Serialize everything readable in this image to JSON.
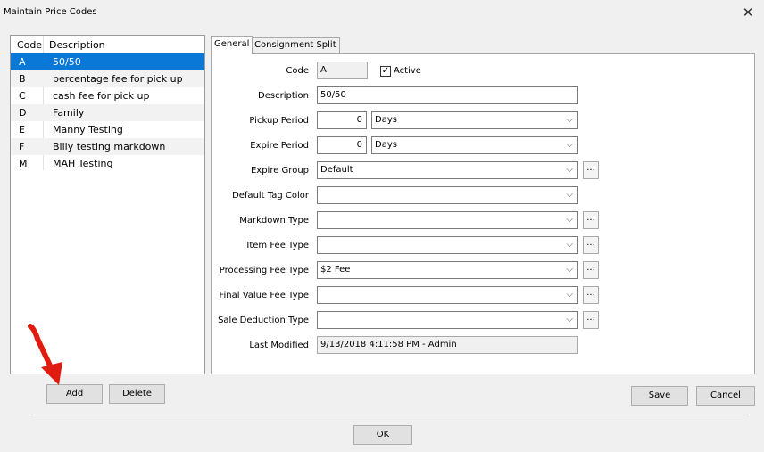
{
  "window": {
    "title": "Maintain Price Codes",
    "close_glyph": "✕"
  },
  "list": {
    "headers": {
      "code": "Code",
      "description": "Description"
    },
    "rows": [
      {
        "code": "A",
        "description": "50/50",
        "selected": true
      },
      {
        "code": "B",
        "description": "percentage fee for pick up"
      },
      {
        "code": "C",
        "description": "cash fee for pick up"
      },
      {
        "code": "D",
        "description": "Family"
      },
      {
        "code": "E",
        "description": "Manny Testing"
      },
      {
        "code": "F",
        "description": "Billy testing markdown"
      },
      {
        "code": "M",
        "description": "MAH Testing"
      }
    ]
  },
  "tabs": [
    {
      "label": "General",
      "active": true
    },
    {
      "label": "Consignment Split",
      "active": false
    }
  ],
  "form": {
    "code": {
      "label": "Code",
      "value": "A"
    },
    "active": {
      "label": "Active",
      "checked": true,
      "glyph": "✓"
    },
    "description": {
      "label": "Description",
      "value": "50/50"
    },
    "pickup_period": {
      "label": "Pickup Period",
      "value": "0",
      "unit": "Days"
    },
    "expire_period": {
      "label": "Expire Period",
      "value": "0",
      "unit": "Days"
    },
    "expire_group": {
      "label": "Expire Group",
      "value": "Default"
    },
    "default_tag_color": {
      "label": "Default Tag Color",
      "value": ""
    },
    "markdown_type": {
      "label": "Markdown Type",
      "value": ""
    },
    "item_fee_type": {
      "label": "Item Fee Type",
      "value": ""
    },
    "processing_fee_type": {
      "label": "Processing Fee Type",
      "value": "$2 Fee"
    },
    "final_value_fee_type": {
      "label": "Final Value Fee Type",
      "value": ""
    },
    "sale_deduction_type": {
      "label": "Sale Deduction Type",
      "value": ""
    },
    "last_modified": {
      "label": "Last Modified",
      "value": "9/13/2018 4:11:58 PM - Admin"
    },
    "chevron_glyph": "⌵",
    "ellipsis_glyph": "..."
  },
  "buttons": {
    "add": "Add",
    "delete": "Delete",
    "save": "Save",
    "cancel": "Cancel",
    "ok": "OK"
  },
  "colors": {
    "selection": "#0a78d7",
    "annotation_arrow": "#e01b10"
  }
}
